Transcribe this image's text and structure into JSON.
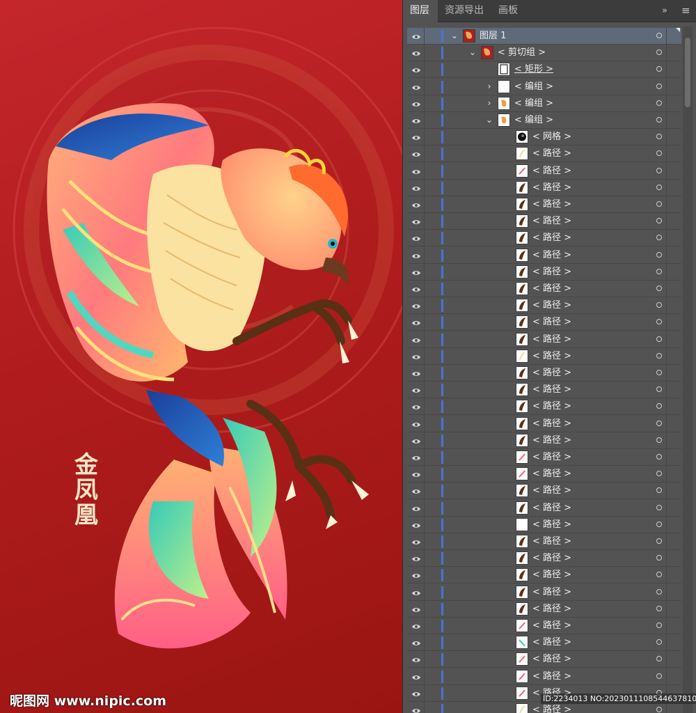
{
  "artwork": {
    "calligraphy_chars": [
      "金",
      "凤",
      "凰"
    ],
    "site_watermark": "昵图网 www.nipic.com",
    "colors": {
      "background": "#b01c1e",
      "gold": "#f3c46a",
      "teal": "#3fd0b7",
      "blue": "#1d4fa8",
      "pink": "#ff6f86",
      "cream": "#f7e7c6"
    }
  },
  "panel": {
    "tabs": [
      {
        "label": "图层",
        "active": true
      },
      {
        "label": "资源导出",
        "active": false
      },
      {
        "label": "画板",
        "active": false
      }
    ],
    "expand_glyph": "»",
    "menu_glyph": "≡",
    "rows": [
      {
        "name": "图层 1",
        "expander": "open",
        "selected": true,
        "thumb": "art"
      },
      {
        "name": "< 剪切组 >",
        "expander": "open",
        "thumb": "art"
      },
      {
        "name": "< 矩形 >",
        "expander": "none",
        "thumb": "rect",
        "underline": true
      },
      {
        "name": "< 编组 >",
        "expander": "closed",
        "thumb": "blank"
      },
      {
        "name": "< 编组 >",
        "expander": "closed",
        "thumb": "bird"
      },
      {
        "name": "< 编组 >",
        "expander": "open",
        "thumb": "bird"
      },
      {
        "name": "< 网格 >",
        "expander": "none",
        "thumb": "mesh"
      },
      {
        "name": "< 路径 >",
        "expander": "none",
        "thumb": "cream"
      },
      {
        "name": "< 路径 >",
        "expander": "none",
        "thumb": "pink"
      },
      {
        "name": "< 路径 >",
        "expander": "none",
        "thumb": "brown"
      },
      {
        "name": "< 路径 >",
        "expander": "none",
        "thumb": "brown"
      },
      {
        "name": "< 路径 >",
        "expander": "none",
        "thumb": "brown"
      },
      {
        "name": "< 路径 >",
        "expander": "none",
        "thumb": "brown"
      },
      {
        "name": "< 路径 >",
        "expander": "none",
        "thumb": "brown"
      },
      {
        "name": "< 路径 >",
        "expander": "none",
        "thumb": "brown"
      },
      {
        "name": "< 路径 >",
        "expander": "none",
        "thumb": "brown"
      },
      {
        "name": "< 路径 >",
        "expander": "none",
        "thumb": "brown"
      },
      {
        "name": "< 路径 >",
        "expander": "none",
        "thumb": "brown"
      },
      {
        "name": "< 路径 >",
        "expander": "none",
        "thumb": "brown"
      },
      {
        "name": "< 路径 >",
        "expander": "none",
        "thumb": "cream"
      },
      {
        "name": "< 路径 >",
        "expander": "none",
        "thumb": "brown"
      },
      {
        "name": "< 路径 >",
        "expander": "none",
        "thumb": "brown"
      },
      {
        "name": "< 路径 >",
        "expander": "none",
        "thumb": "brown"
      },
      {
        "name": "< 路径 >",
        "expander": "none",
        "thumb": "brown"
      },
      {
        "name": "< 路径 >",
        "expander": "none",
        "thumb": "brown"
      },
      {
        "name": "< 路径 >",
        "expander": "none",
        "thumb": "pink"
      },
      {
        "name": "< 路径 >",
        "expander": "none",
        "thumb": "pink"
      },
      {
        "name": "< 路径 >",
        "expander": "none",
        "thumb": "brown"
      },
      {
        "name": "< 路径 >",
        "expander": "none",
        "thumb": "brown"
      },
      {
        "name": "< 路径 >",
        "expander": "none",
        "thumb": "blank"
      },
      {
        "name": "< 路径 >",
        "expander": "none",
        "thumb": "brown"
      },
      {
        "name": "< 路径 >",
        "expander": "none",
        "thumb": "brown"
      },
      {
        "name": "< 路径 >",
        "expander": "none",
        "thumb": "brown"
      },
      {
        "name": "< 路径 >",
        "expander": "none",
        "thumb": "brown"
      },
      {
        "name": "< 路径 >",
        "expander": "none",
        "thumb": "brown"
      },
      {
        "name": "< 路径 >",
        "expander": "none",
        "thumb": "pink"
      },
      {
        "name": "< 路径 >",
        "expander": "none",
        "thumb": "teal"
      },
      {
        "name": "< 路径 >",
        "expander": "none",
        "thumb": "pink"
      },
      {
        "name": "< 路径 >",
        "expander": "none",
        "thumb": "pink"
      },
      {
        "name": "< 路径 >",
        "expander": "none",
        "thumb": "pink"
      },
      {
        "name": "< 路径 >",
        "expander": "none",
        "thumb": "cream"
      }
    ],
    "id_stamp": "ID:2234013 NO:20230111085446378101"
  }
}
